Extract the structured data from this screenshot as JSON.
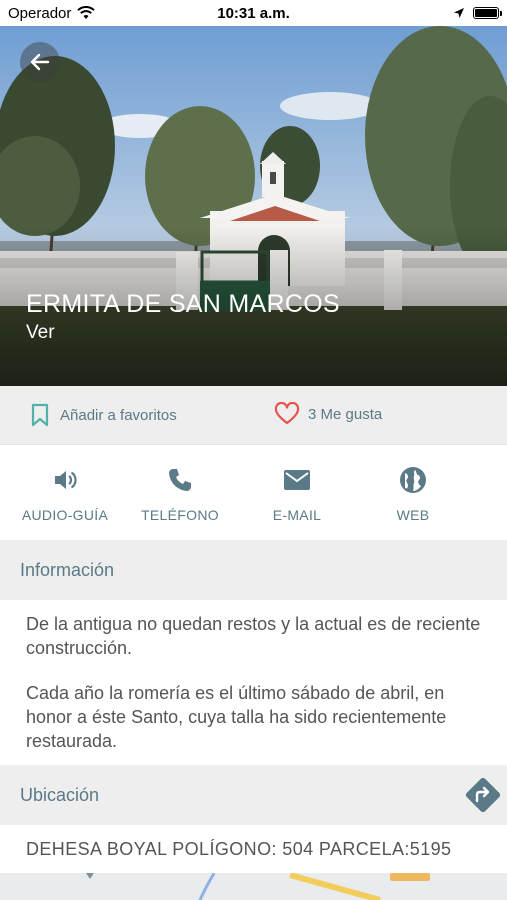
{
  "status": {
    "carrier": "Operador",
    "time": "10:31 a.m."
  },
  "hero": {
    "title": "ERMITA DE SAN MARCOS",
    "subtitle": "Ver"
  },
  "actions": {
    "favorite_label": "Añadir a favoritos",
    "likes_label": "3 Me gusta"
  },
  "contacts": [
    {
      "label": "AUDIO-GUÍA",
      "icon": "speaker-icon"
    },
    {
      "label": "TELÉFONO",
      "icon": "phone-icon"
    },
    {
      "label": "E-MAIL",
      "icon": "mail-icon"
    },
    {
      "label": "WEB",
      "icon": "globe-icon"
    }
  ],
  "info": {
    "header": "Información",
    "paragraphs": [
      "De la antigua no quedan restos y la actual es de reciente construcción.",
      "Cada año la romería es el último sábado de abril, en honor a éste Santo, cuya talla ha sido recientemente restaurada."
    ]
  },
  "location": {
    "header": "Ubicación",
    "address": "DEHESA BOYAL POLÍGONO: 504 PARCELA:5195"
  },
  "colors": {
    "accent": "#5b7a87",
    "heart": "#e5534b",
    "bookmark": "#4fb3a9",
    "section_bg": "#eeeeee"
  }
}
